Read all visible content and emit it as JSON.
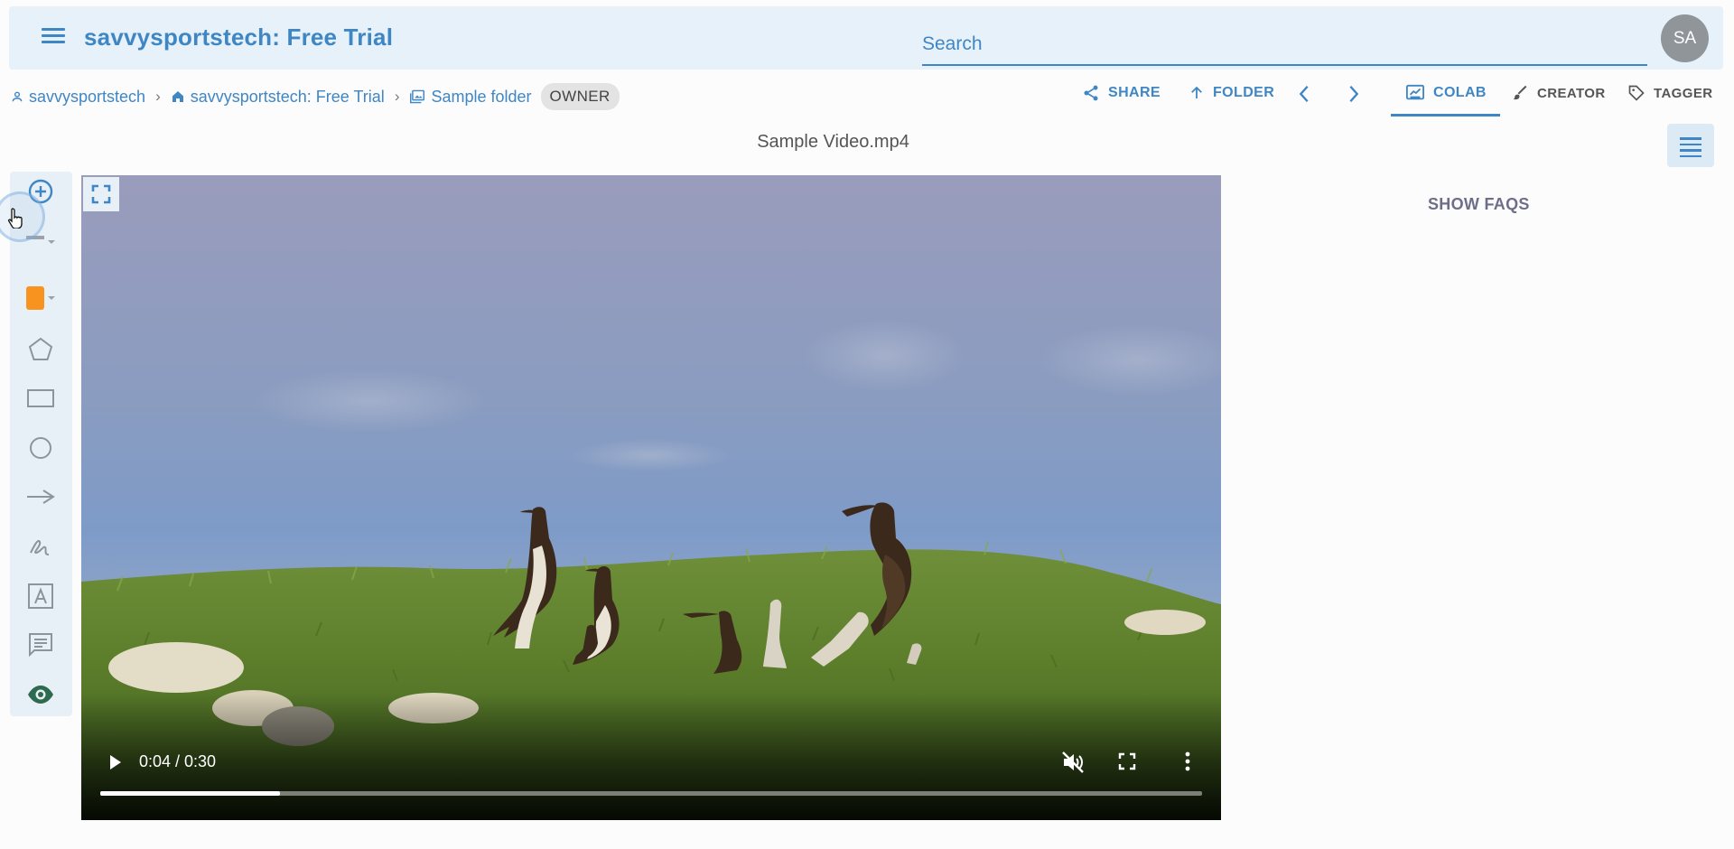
{
  "header": {
    "title": "savvysportstech: Free Trial",
    "search_placeholder": "Search",
    "avatar_initials": "SA"
  },
  "breadcrumb": {
    "items": [
      "savvysportstech",
      "savvysportstech: Free Trial",
      "Sample folder"
    ],
    "role_badge": "OWNER"
  },
  "actions": {
    "share": "SHARE",
    "folder": "FOLDER",
    "colab": "COLAB",
    "creator": "CREATOR",
    "tagger": "TAGGER"
  },
  "file": {
    "name": "Sample Video.mp4"
  },
  "toolbar": {
    "tools": [
      "add-icon",
      "line-style-icon",
      "color-swatch",
      "pentagon-icon",
      "rectangle-icon",
      "circle-icon",
      "arrow-icon",
      "freehand-icon",
      "text-icon",
      "comment-icon",
      "eye-icon"
    ],
    "color": "#f7931e"
  },
  "player": {
    "time": "0:04 / 0:30",
    "progress": 0.163,
    "muted": true
  },
  "side_panel": {
    "show_faqs": "SHOW FAQS"
  },
  "colors": {
    "accent": "#3f86c4",
    "header_bg": "#e6f1fa"
  }
}
